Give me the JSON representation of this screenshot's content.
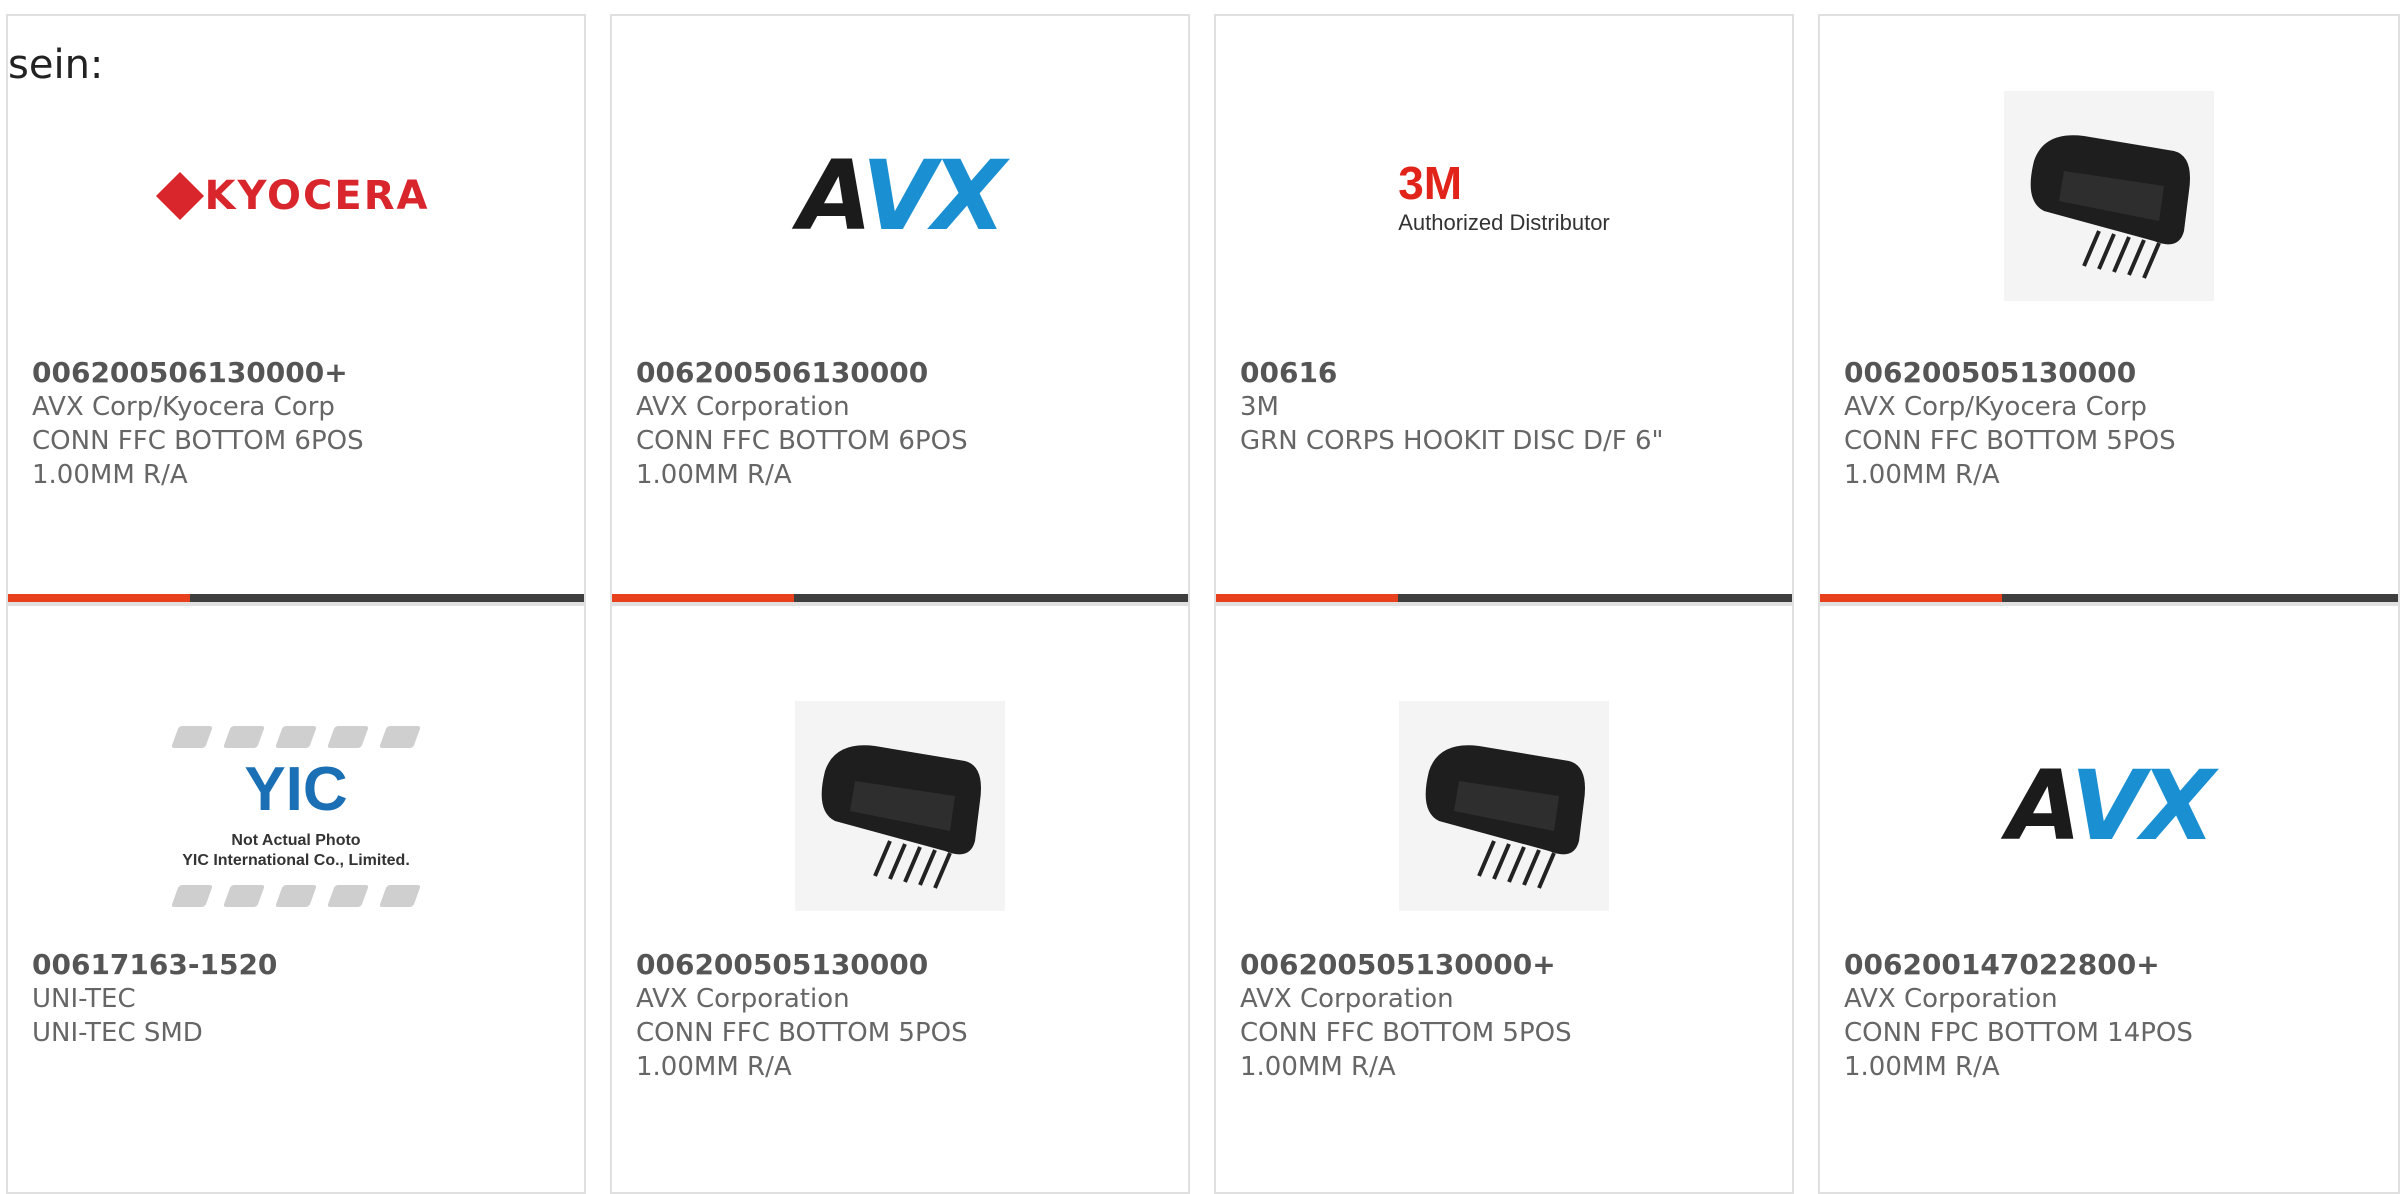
{
  "stray_text": "sein:",
  "products": [
    {
      "part_number": "006200506130000+",
      "manufacturer": "AVX Corp/Kyocera Corp",
      "desc_line1": "CONN FFC BOTTOM 6POS",
      "desc_line2": "1.00MM R/A",
      "image": "kyocera-logo"
    },
    {
      "part_number": "006200506130000",
      "manufacturer": "AVX Corporation",
      "desc_line1": "CONN FFC BOTTOM 6POS",
      "desc_line2": "1.00MM R/A",
      "image": "avx-logo"
    },
    {
      "part_number": "00616",
      "manufacturer": "3M",
      "desc_line1": "GRN CORPS HOOKIT DISC D/F 6\"",
      "desc_line2": "",
      "image": "3m-logo"
    },
    {
      "part_number": "006200505130000",
      "manufacturer": "AVX Corp/Kyocera Corp",
      "desc_line1": "CONN FFC BOTTOM 5POS",
      "desc_line2": "1.00MM R/A",
      "image": "connector-photo"
    },
    {
      "part_number": "00617163-1520",
      "manufacturer": "UNI-TEC",
      "desc_line1": "UNI-TEC SMD",
      "desc_line2": "",
      "image": "yic-placeholder"
    },
    {
      "part_number": "006200505130000",
      "manufacturer": "AVX Corporation",
      "desc_line1": "CONN FFC BOTTOM 5POS",
      "desc_line2": "1.00MM R/A",
      "image": "connector-photo"
    },
    {
      "part_number": "006200505130000+",
      "manufacturer": "AVX Corporation",
      "desc_line1": "CONN FFC BOTTOM 5POS",
      "desc_line2": "1.00MM R/A",
      "image": "connector-photo"
    },
    {
      "part_number": "006200147022800+",
      "manufacturer": "AVX Corporation",
      "desc_line1": "CONN FPC BOTTOM 14POS",
      "desc_line2": "1.00MM R/A",
      "image": "avx-logo"
    }
  ],
  "logos": {
    "kyocera": "KYOCERA",
    "avx_a": "A",
    "avx_vx": "VX",
    "mmm_big": "3M",
    "mmm_small": "Authorized Distributor",
    "yic_logo": "YIC",
    "yic_caption1": "Not Actual Photo",
    "yic_caption2": "YIC International Co., Limited."
  },
  "colors": {
    "accent": "#e8401c",
    "bar": "#3e3e3e",
    "avx_blue": "#1a8fd2",
    "kyocera_red": "#d8262c",
    "mmm_red": "#e2231a"
  }
}
